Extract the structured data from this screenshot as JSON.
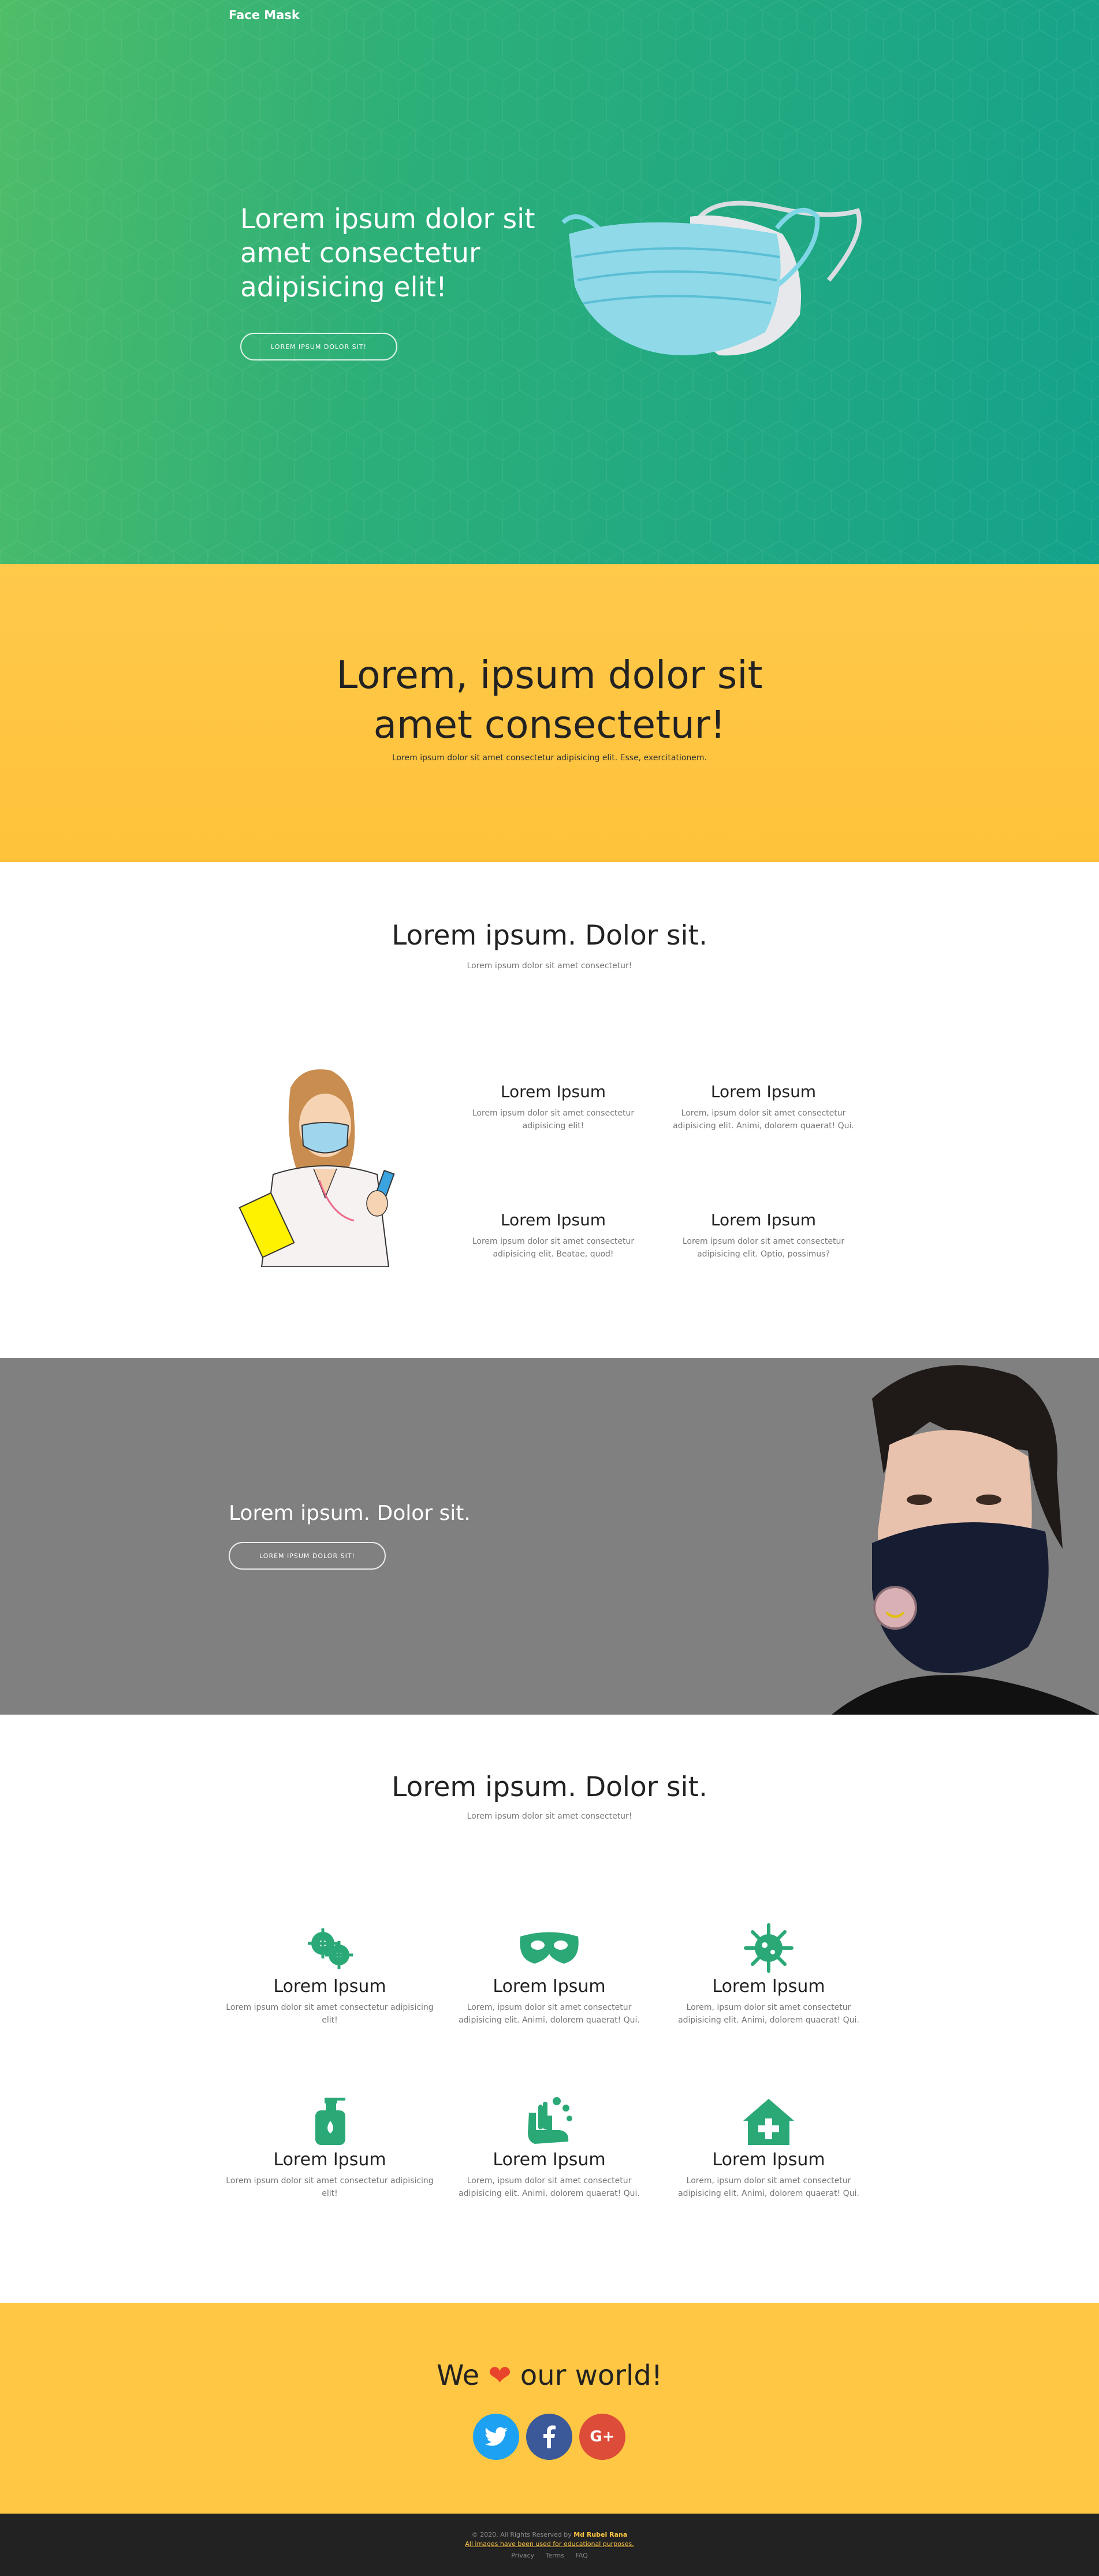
{
  "brand": "Face Mask",
  "hero": {
    "title": "Lorem ipsum dolor sit amet consectetur adipisicing elit!",
    "button": "LOREM IPSUM DOLOR SIT!"
  },
  "band1": {
    "title_line1": "Lorem, ipsum dolor sit",
    "title_line2": "amet consectetur!",
    "subtitle": "Lorem ipsum dolor sit amet consectetur adipisicing elit. Esse, exercitationem."
  },
  "section1": {
    "title": "Lorem ipsum. Dolor sit.",
    "subtitle": "Lorem ipsum dolor sit amet consectetur!",
    "features": [
      {
        "title": "Lorem Ipsum",
        "text": "Lorem ipsum dolor sit amet consectetur adipisicing elit!"
      },
      {
        "title": "Lorem Ipsum",
        "text": "Lorem, ipsum dolor sit amet consectetur adipisicing elit. Animi, dolorem quaerat! Qui."
      },
      {
        "title": "Lorem Ipsum",
        "text": "Lorem ipsum dolor sit amet consectetur adipisicing elit. Beatae, quod!"
      },
      {
        "title": "Lorem Ipsum",
        "text": "Lorem ipsum dolor sit amet consectetur adipisicing elit. Optio, possimus?"
      }
    ]
  },
  "gray_band": {
    "title": "Lorem ipsum. Dolor sit.",
    "button": "LOREM IPSUM DOLOR SIT!"
  },
  "section2": {
    "title": "Lorem ipsum. Dolor sit.",
    "subtitle": "Lorem ipsum dolor sit amet consectetur!",
    "items": [
      {
        "icon": "virus-cells-icon",
        "title": "Lorem Ipsum",
        "text": "Lorem ipsum dolor sit amet consectetur adipisicing elit!"
      },
      {
        "icon": "mask-icon",
        "title": "Lorem Ipsum",
        "text": "Lorem, ipsum dolor sit amet consectetur adipisicing elit. Animi, dolorem quaerat! Qui."
      },
      {
        "icon": "virus-icon",
        "title": "Lorem Ipsum",
        "text": "Lorem, ipsum dolor sit amet consectetur adipisicing elit. Animi, dolorem quaerat! Qui."
      },
      {
        "icon": "hand-sanitizer-icon",
        "title": "Lorem Ipsum",
        "text": "Lorem ipsum dolor sit amet consectetur adipisicing elit!"
      },
      {
        "icon": "hands-wash-icon",
        "title": "Lorem Ipsum",
        "text": "Lorem, ipsum dolor sit amet consectetur adipisicing elit. Animi, dolorem quaerat! Qui."
      },
      {
        "icon": "clinic-house-icon",
        "title": "Lorem Ipsum",
        "text": "Lorem, ipsum dolor sit amet consectetur adipisicing elit. Animi, dolorem quaerat! Qui."
      }
    ]
  },
  "band2": {
    "love_pre": "We",
    "love_post": "our world!",
    "heart": "❤",
    "social": [
      {
        "icon": "twitter-icon",
        "color": "#1da1f2"
      },
      {
        "icon": "facebook-icon",
        "color": "#3b5998"
      },
      {
        "icon": "google-plus-icon",
        "color": "#dd4b39"
      }
    ]
  },
  "footer": {
    "copyright": "© 2020. All Rights Reserved by",
    "author": "Md Rubel Rana",
    "note": "All images have been used for educational purposes.",
    "links": [
      "Privacy",
      "Terms",
      "FAQ"
    ]
  },
  "colors": {
    "accent_green": "#2aa876",
    "yellow": "#ffc743",
    "gray": "#808080",
    "footer": "#222222"
  }
}
